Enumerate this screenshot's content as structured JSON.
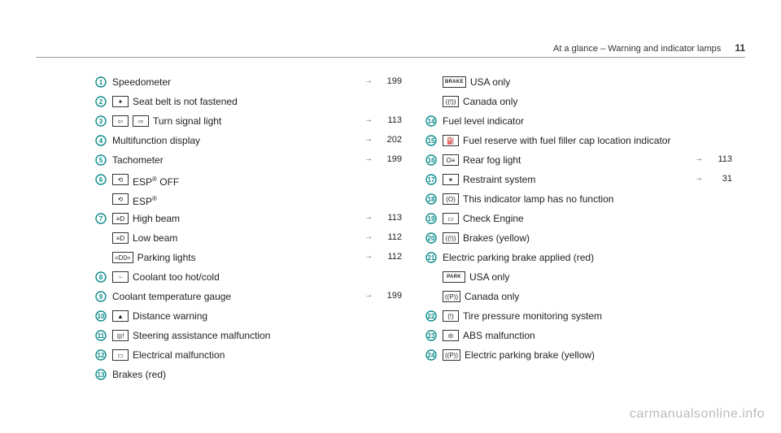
{
  "header": {
    "title": "At a glance – Warning and indicator lamps",
    "page": "11"
  },
  "left": [
    {
      "n": 1,
      "icons": [],
      "label": "Speedometer",
      "ref": "199"
    },
    {
      "n": 2,
      "icons": [
        "seat"
      ],
      "label": "Seat belt is not fastened",
      "ref": ""
    },
    {
      "n": 3,
      "icons": [
        "tl",
        "tr"
      ],
      "label": "Turn signal light",
      "ref": "113"
    },
    {
      "n": 4,
      "icons": [],
      "label": "Multifunction display",
      "ref": "202"
    },
    {
      "n": 5,
      "icons": [],
      "label": "Tachometer",
      "ref": "199"
    },
    {
      "n": 6,
      "icons": [
        "espoff"
      ],
      "label": "ESP® OFF",
      "ref": ""
    },
    {
      "n": 0,
      "icons": [
        "esp"
      ],
      "label": "ESP®",
      "ref": ""
    },
    {
      "n": 7,
      "icons": [
        "hibeam"
      ],
      "label": "High beam",
      "ref": "113"
    },
    {
      "n": 0,
      "icons": [
        "lobeam"
      ],
      "label": "Low beam",
      "ref": "112"
    },
    {
      "n": 0,
      "icons": [
        "park"
      ],
      "label": "Parking lights",
      "ref": "112"
    },
    {
      "n": 8,
      "icons": [
        "coolant"
      ],
      "label": "Coolant too hot/cold",
      "ref": ""
    },
    {
      "n": 9,
      "icons": [],
      "label": "Coolant temperature gauge",
      "ref": "199"
    },
    {
      "n": 10,
      "icons": [
        "dist"
      ],
      "label": "Distance warning",
      "ref": ""
    },
    {
      "n": 11,
      "icons": [
        "steer"
      ],
      "label": "Steering assistance malfunction",
      "ref": ""
    },
    {
      "n": 12,
      "icons": [
        "batt"
      ],
      "label": "Electrical malfunction",
      "ref": ""
    },
    {
      "n": 13,
      "icons": [],
      "label": "Brakes (red)",
      "ref": ""
    }
  ],
  "right": [
    {
      "n": 0,
      "icons": [
        "brakeus"
      ],
      "label": "USA only",
      "ref": ""
    },
    {
      "n": 0,
      "icons": [
        "brakeca"
      ],
      "label": "Canada only",
      "ref": ""
    },
    {
      "n": 14,
      "icons": [],
      "label": "Fuel level indicator",
      "ref": ""
    },
    {
      "n": 15,
      "icons": [
        "fuel"
      ],
      "label": "Fuel reserve with fuel filler cap location indicator",
      "ref": ""
    },
    {
      "n": 16,
      "icons": [
        "rfog"
      ],
      "label": "Rear fog light",
      "ref": "113"
    },
    {
      "n": 17,
      "icons": [
        "restr"
      ],
      "label": "Restraint system",
      "ref": "31"
    },
    {
      "n": 18,
      "icons": [
        "nofn"
      ],
      "label": "This indicator lamp has no function",
      "ref": ""
    },
    {
      "n": 19,
      "icons": [
        "engine"
      ],
      "label": "Check Engine",
      "ref": ""
    },
    {
      "n": 20,
      "icons": [
        "brky"
      ],
      "label": "Brakes (yellow)",
      "ref": ""
    },
    {
      "n": 21,
      "icons": [],
      "label": "Electric parking brake applied (red)",
      "ref": ""
    },
    {
      "n": 0,
      "icons": [
        "parkus"
      ],
      "label": "USA only",
      "ref": ""
    },
    {
      "n": 0,
      "icons": [
        "parkca"
      ],
      "label": "Canada only",
      "ref": ""
    },
    {
      "n": 22,
      "icons": [
        "tpms"
      ],
      "label": "Tire pressure monitoring system",
      "ref": ""
    },
    {
      "n": 23,
      "icons": [
        "abs"
      ],
      "label": "ABS malfunction",
      "ref": ""
    },
    {
      "n": 24,
      "icons": [
        "epby"
      ],
      "label": "Electric parking brake (yellow)",
      "ref": ""
    }
  ],
  "watermark": "carmanualsonline.info",
  "iconGlyphs": {
    "seat": "✦",
    "tl": "⇦",
    "tr": "⇨",
    "espoff": "⟲",
    "esp": "⟲",
    "hibeam": "≡D",
    "lobeam": "≡D",
    "park": "=D0=",
    "coolant": "~",
    "dist": "▲",
    "steer": "◎!",
    "batt": "▭",
    "brakeus": "BRAKE",
    "brakeca": "((!))",
    "fuel": "⛽",
    "rfog": "O≡",
    "restr": "✶",
    "nofn": "(O)",
    "engine": "▭",
    "brky": "((!))",
    "parkus": "PARK",
    "parkca": "((P))",
    "tpms": "(!)",
    "abs": "⊝",
    "epby": "((P))"
  }
}
